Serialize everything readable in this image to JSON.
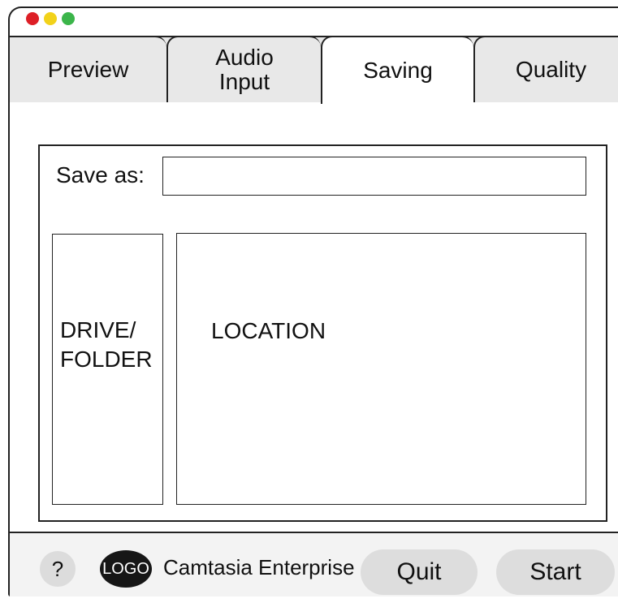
{
  "window": {
    "traffic_lights": [
      "close",
      "minimize",
      "zoom"
    ]
  },
  "tabs": [
    {
      "label": "Preview",
      "active": false
    },
    {
      "label": "Audio\nInput",
      "active": false
    },
    {
      "label": "Saving",
      "active": true
    },
    {
      "label": "Quality",
      "active": false
    }
  ],
  "saving": {
    "save_as_label": "Save as:",
    "save_as_value": "",
    "drive_label": "DRIVE/\nFOLDER",
    "location_label": "LOCATION"
  },
  "footer": {
    "help_label": "?",
    "logo_text": "LOGO",
    "product_name": "Camtasia Enterprise",
    "quit_label": "Quit",
    "start_label": "Start"
  },
  "colors": {
    "close": "#dd1f26",
    "minimize": "#f2d21a",
    "zoom": "#3bb54a",
    "tab_inactive": "#e8e8e8",
    "button_fill": "#dddddd"
  }
}
